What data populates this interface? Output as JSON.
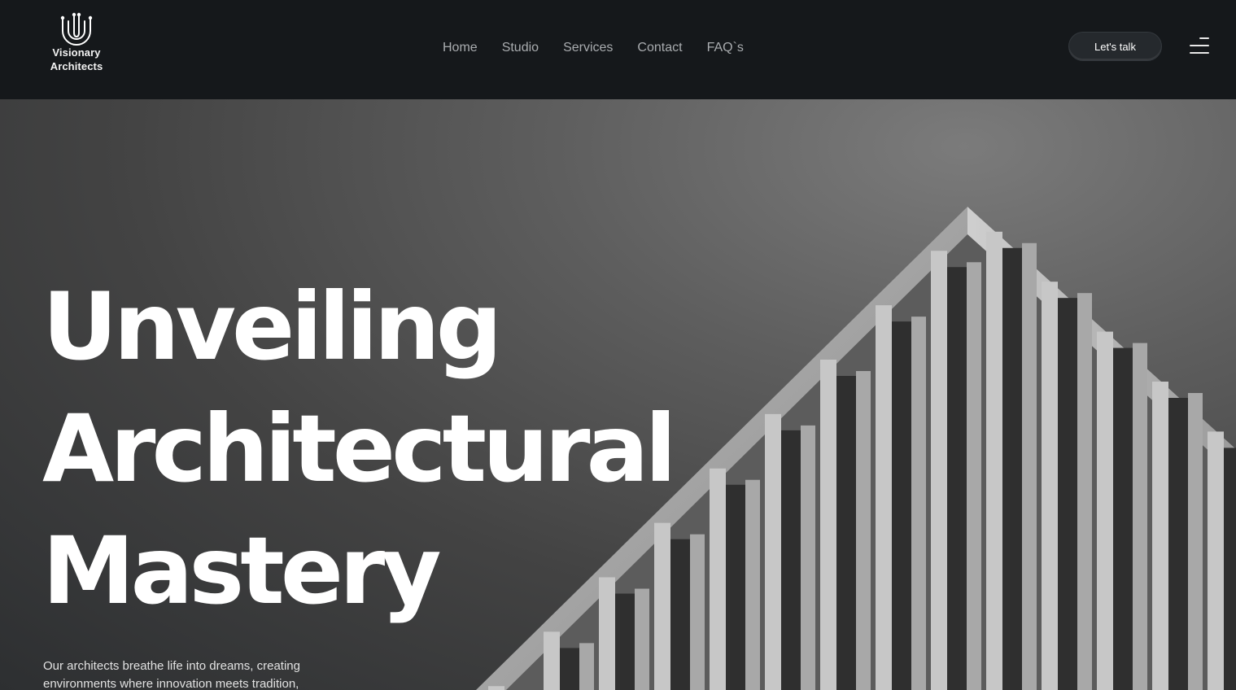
{
  "brand": {
    "name_line1": "Visionary",
    "name_line2": "Architects"
  },
  "nav": {
    "items": [
      {
        "label": "Home"
      },
      {
        "label": "Studio"
      },
      {
        "label": "Services"
      },
      {
        "label": "Contact"
      },
      {
        "label": "FAQ`s"
      }
    ]
  },
  "header": {
    "cta_label": "Let's talk",
    "menu_icon": "hamburger-menu-icon"
  },
  "hero": {
    "headline_line1": "Unveiling",
    "headline_line2": "Architectural",
    "headline_line3": "Mastery",
    "description": "Our architects breathe life into dreams, creating environments where innovation meets tradition,",
    "image": "skyscraper-photo"
  },
  "colors": {
    "header_bg": "#15181b",
    "text": "#ffffff",
    "nav_text": "#a9acaf",
    "button_bg": "#25292d"
  }
}
